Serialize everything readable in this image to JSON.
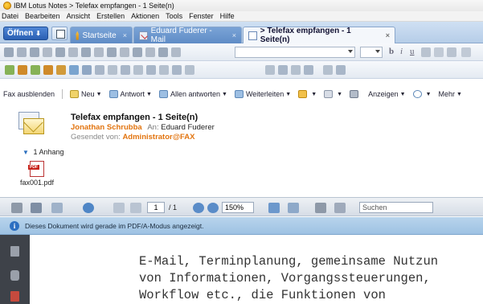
{
  "window": {
    "title": "IBM Lotus Notes > Telefax empfangen - 1 Seite(n)"
  },
  "menu": [
    "Datei",
    "Bearbeiten",
    "Ansicht",
    "Erstellen",
    "Aktionen",
    "Tools",
    "Fenster",
    "Hilfe"
  ],
  "tabs": {
    "open_label": "Öffnen",
    "items": [
      {
        "label": "Startseite",
        "icon": "home-icon"
      },
      {
        "label": "Eduard Fuderer - Mail",
        "icon": "mail-icon"
      },
      {
        "label": "> Telefax empfangen - 1 Seite(n)",
        "icon": "document-icon"
      }
    ],
    "close_glyph": "×"
  },
  "formatting": {
    "bold": "b",
    "italic": "i",
    "underline": "u"
  },
  "actions": {
    "hide_fax": "Fax ausblenden",
    "new": "Neu",
    "reply": "Antwort",
    "reply_all": "Allen antworten",
    "forward": "Weiterleiten",
    "show": "Anzeigen",
    "more": "Mehr"
  },
  "message": {
    "subject": "Telefax empfangen - 1 Seite(n)",
    "from": "Jonathan Schrubba",
    "to_label": "An:",
    "to": "Eduard Fuderer",
    "sent_by_label": "Gesendet von:",
    "sent_by": "Administrator@FAX",
    "attachments_label": "1 Anhang",
    "attachment_file": "fax001.pdf",
    "pdf_badge": "PDF"
  },
  "pdf_viewer": {
    "page_current": "1",
    "page_total": "/ 1",
    "zoom": "150%",
    "search_placeholder": "Suchen",
    "info": "Dieses Dokument wird gerade im PDF/A-Modus angezeigt.",
    "content_lines": [
      "E-Mail, Terminplanung, gemeinsame Nutzun",
      "von Informationen, Vorgangssteuerungen,",
      "Workflow etc., die Funktionen von"
    ]
  },
  "colors": {
    "accent": "#e2740f",
    "tab_blue": "#2a5fb3",
    "info_bar": "#b8d4ec",
    "side_panel": "#3e4249"
  }
}
